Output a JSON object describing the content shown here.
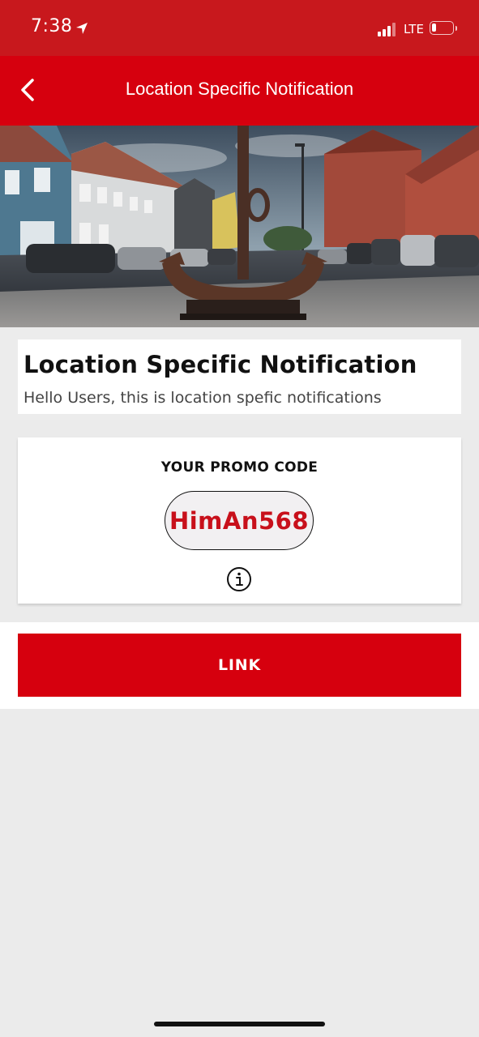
{
  "status_bar": {
    "time": "7:38",
    "network": "LTE",
    "location_icon": "location-arrow-icon",
    "signal_icon": "cellular-signal-icon",
    "battery_icon": "battery-low-icon"
  },
  "nav": {
    "title": "Location Specific Notification",
    "back_icon": "chevron-left-icon"
  },
  "hero": {
    "image": "photo of a large rusted anchor on a cobblestone street with colorful houses"
  },
  "notification": {
    "title": "Location Specific Notification",
    "message": "Hello Users, this is location spefic notifications"
  },
  "promo": {
    "label": "YOUR PROMO CODE",
    "code": "HimAn568",
    "info_icon": "info-circle-icon"
  },
  "link_button": {
    "label": "LINK"
  },
  "colors": {
    "status_bar": "#c8181d",
    "nav_bar": "#d6000e",
    "promo_code": "#c8101b",
    "background": "#ebebeb"
  }
}
